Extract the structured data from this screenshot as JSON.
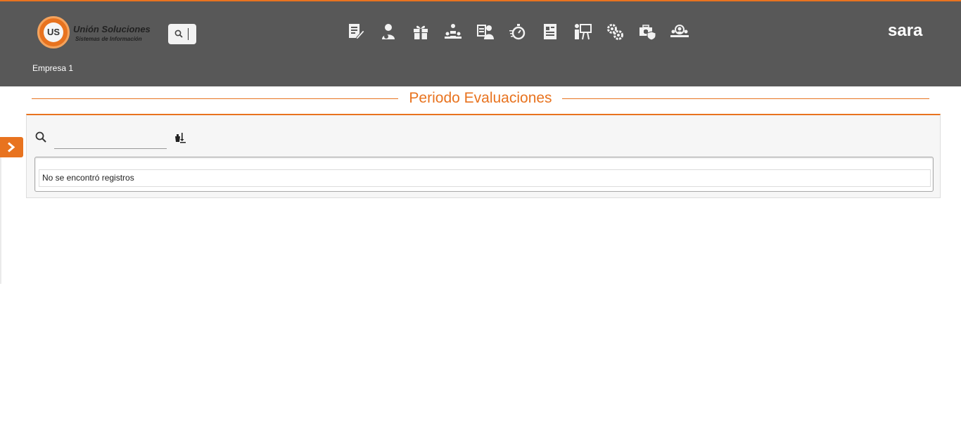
{
  "header": {
    "logo": {
      "mark": "US",
      "title": "Unión Soluciones",
      "subtitle": "Sistemas de Información"
    },
    "search": {
      "icon": "search-icon"
    },
    "modules": [
      {
        "icon": "document-edit-icon"
      },
      {
        "icon": "person-icon"
      },
      {
        "icon": "gift-icon"
      },
      {
        "icon": "org-chart-icon"
      },
      {
        "icon": "person-list-icon"
      },
      {
        "icon": "stopwatch-icon"
      },
      {
        "icon": "document-icon"
      },
      {
        "icon": "presentation-icon"
      },
      {
        "icon": "gears-icon"
      },
      {
        "icon": "medical-kit-shield-icon"
      },
      {
        "icon": "team-icon"
      }
    ],
    "brand": "sara",
    "company": "Empresa 1"
  },
  "page": {
    "title": "Periodo Evaluaciones"
  },
  "filter": {
    "value": "",
    "placeholder": ""
  },
  "table": {
    "empty_message": "No se encontró registros"
  },
  "colors": {
    "accent": "#e8731f",
    "header_bg": "#585858",
    "panel_bg": "#f6f6f6"
  }
}
